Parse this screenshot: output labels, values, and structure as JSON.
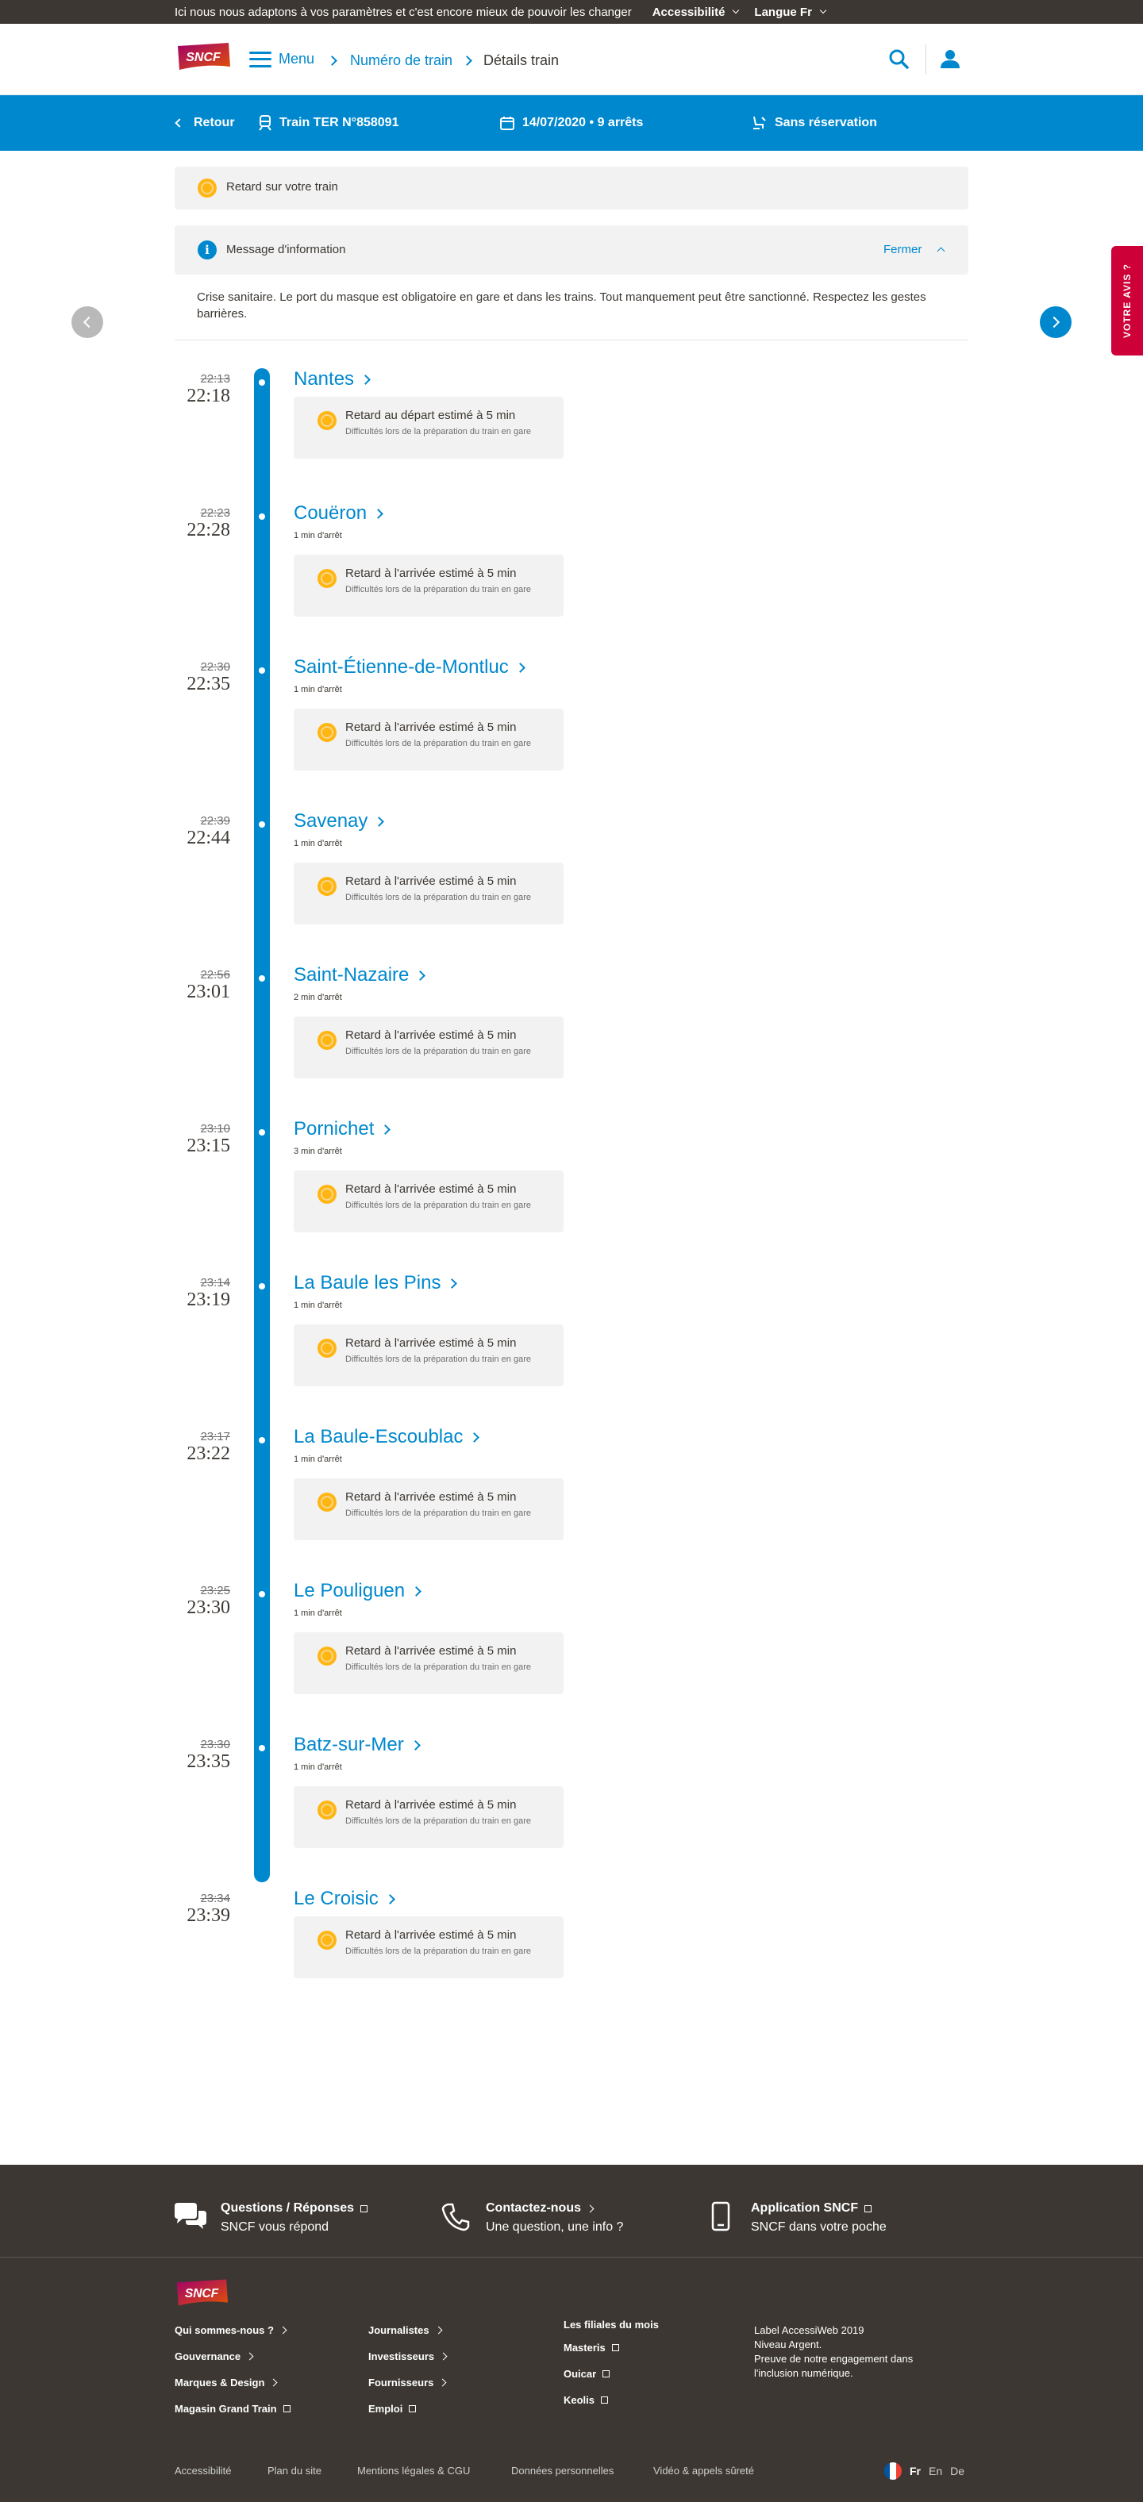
{
  "topbar": {
    "message": "Ici nous nous adaptons à vos paramètres et c'est encore mieux de pouvoir les changer",
    "accessibility": "Accessibilité",
    "language": "Langue Fr"
  },
  "header": {
    "logo_text": "SNCF",
    "menu_label": "Menu",
    "breadcrumb": [
      "Numéro de train",
      "Détails train"
    ],
    "icons": [
      "search-icon",
      "user-icon"
    ]
  },
  "bluebar": {
    "back_label": "Retour",
    "train": "Train TER N°858091",
    "date_stops": "14/07/2020 • 9 arrêts",
    "reservation": "Sans réservation"
  },
  "alerts": {
    "delay_label": "Retard sur votre train",
    "info_title": "Message d'information",
    "close_label": "Fermer",
    "info_text": "Crise sanitaire. Le port du masque est obligatoire en gare et dans les trains. Tout manquement peut être sanctionné. Respectez les gestes barrières."
  },
  "feedback_label": "VOTRE AVIS ?",
  "stops": [
    {
      "sched": "22:13",
      "est": "22:18",
      "name": "Nantes",
      "stop_duration": "",
      "delay_title": "Retard au départ estimé à 5 min",
      "delay_sub": "Difficultés lors de la préparation du train en gare"
    },
    {
      "sched": "22:23",
      "est": "22:28",
      "name": "Couëron",
      "stop_duration": "1 min d'arrêt",
      "delay_title": "Retard à l'arrivée estimé à 5 min",
      "delay_sub": "Difficultés lors de la préparation du train en gare"
    },
    {
      "sched": "22:30",
      "est": "22:35",
      "name": "Saint-Étienne-de-Montluc",
      "stop_duration": "1 min d'arrêt",
      "delay_title": "Retard à l'arrivée estimé à 5 min",
      "delay_sub": "Difficultés lors de la préparation du train en gare"
    },
    {
      "sched": "22:39",
      "est": "22:44",
      "name": "Savenay",
      "stop_duration": "1 min d'arrêt",
      "delay_title": "Retard à l'arrivée estimé à 5 min",
      "delay_sub": "Difficultés lors de la préparation du train en gare"
    },
    {
      "sched": "22:56",
      "est": "23:01",
      "name": "Saint-Nazaire",
      "stop_duration": "2 min d'arrêt",
      "delay_title": "Retard à l'arrivée estimé à 5 min",
      "delay_sub": "Difficultés lors de la préparation du train en gare"
    },
    {
      "sched": "23:10",
      "est": "23:15",
      "name": "Pornichet",
      "stop_duration": "3 min d'arrêt",
      "delay_title": "Retard à l'arrivée estimé à 5 min",
      "delay_sub": "Difficultés lors de la préparation du train en gare"
    },
    {
      "sched": "23:14",
      "est": "23:19",
      "name": "La Baule les Pins",
      "stop_duration": "1 min d'arrêt",
      "delay_title": "Retard à l'arrivée estimé à 5 min",
      "delay_sub": "Difficultés lors de la préparation du train en gare"
    },
    {
      "sched": "23:17",
      "est": "23:22",
      "name": "La Baule-Escoublac",
      "stop_duration": "1 min d'arrêt",
      "delay_title": "Retard à l'arrivée estimé à 5 min",
      "delay_sub": "Difficultés lors de la préparation du train en gare"
    },
    {
      "sched": "23:25",
      "est": "23:30",
      "name": "Le Pouliguen",
      "stop_duration": "1 min d'arrêt",
      "delay_title": "Retard à l'arrivée estimé à 5 min",
      "delay_sub": "Difficultés lors de la préparation du train en gare"
    },
    {
      "sched": "23:30",
      "est": "23:35",
      "name": "Batz-sur-Mer",
      "stop_duration": "1 min d'arrêt",
      "delay_title": "Retard à l'arrivée estimé à 5 min",
      "delay_sub": "Difficultés lors de la préparation du train en gare"
    },
    {
      "sched": "23:34",
      "est": "23:39",
      "name": "Le Croisic",
      "stop_duration": "",
      "delay_title": "Retard à l'arrivée estimé à 5 min",
      "delay_sub": "Difficultés lors de la préparation du train en gare"
    }
  ],
  "footer": {
    "quick": [
      {
        "title": "Questions / Réponses",
        "subtitle": "SNCF vous répond",
        "icon": "chat-icon"
      },
      {
        "title": "Contactez-nous",
        "subtitle": "Une question, une info ?",
        "icon": "phone-icon"
      },
      {
        "title": "Application SNCF",
        "subtitle": "SNCF dans votre poche",
        "icon": "mobile-icon"
      }
    ],
    "logo_text": "SNCF",
    "col1": [
      "Qui sommes-nous ?",
      "Gouvernance",
      "Marques & Design",
      "Magasin Grand Train"
    ],
    "col2": [
      "Journalistes",
      "Investisseurs",
      "Fournisseurs",
      "Emploi"
    ],
    "col3_title": "Les filiales du mois",
    "col3": [
      "Masteris",
      "Ouicar",
      "Keolis"
    ],
    "label_lines": [
      "Label AccessiWeb 2019",
      "Niveau Argent.",
      "Preuve de notre engagement dans",
      "l'inclusion numérique."
    ],
    "bottom_links": [
      "Accessibilité",
      "Plan du site",
      "Mentions légales & CGU",
      "Données personnelles",
      "Vidéo & appels sûreté"
    ],
    "languages": [
      "Fr",
      "En",
      "De"
    ]
  }
}
